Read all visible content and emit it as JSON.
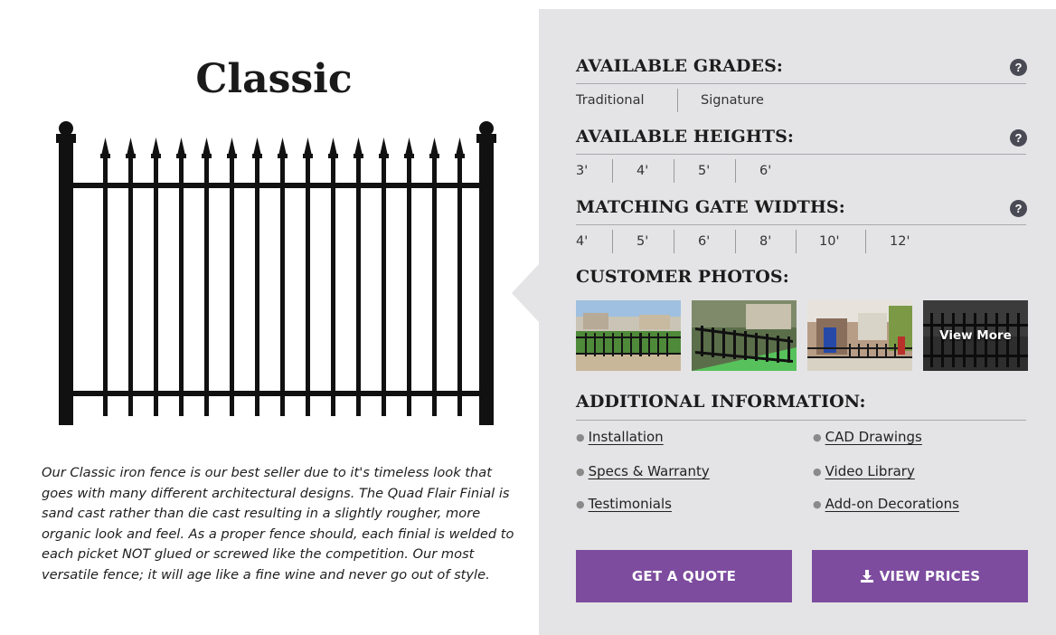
{
  "product": {
    "title": "Classic",
    "description": "Our Classic iron fence is our best seller due to it's timeless look that goes with many different architectural designs. The Quad Flair Finial is sand cast rather than die cast resulting in a slightly rougher, more organic look and feel. As a proper fence should, each finial is welded to each picket NOT glued or screwed like the competition. Our most versatile fence; it will age like a fine wine and never go out of style."
  },
  "grades": {
    "title": "AVAILABLE GRADES:",
    "options": [
      "Traditional",
      "Signature"
    ]
  },
  "heights": {
    "title": "AVAILABLE HEIGHTS:",
    "options": [
      "3'",
      "4'",
      "5'",
      "6'"
    ]
  },
  "gate_widths": {
    "title": "MATCHING GATE WIDTHS:",
    "options": [
      "4'",
      "5'",
      "6'",
      "8'",
      "10'",
      "12'"
    ]
  },
  "help_glyph": "?",
  "photos": {
    "title": "CUSTOMER PHOTOS:",
    "view_more_label": "View More"
  },
  "additional_info": {
    "title": "ADDITIONAL INFORMATION:",
    "links": [
      "Installation",
      "CAD Drawings",
      "Specs & Warranty",
      "Video Library",
      "Testimonials",
      "Add-on Decorations"
    ]
  },
  "actions": {
    "quote_label": "GET A QUOTE",
    "prices_label": "VIEW PRICES",
    "prices_icon": "download-icon"
  },
  "colors": {
    "accent": "#7d4c9f",
    "panel": "#e4e4e6",
    "help_icon": "#4a4a55"
  }
}
